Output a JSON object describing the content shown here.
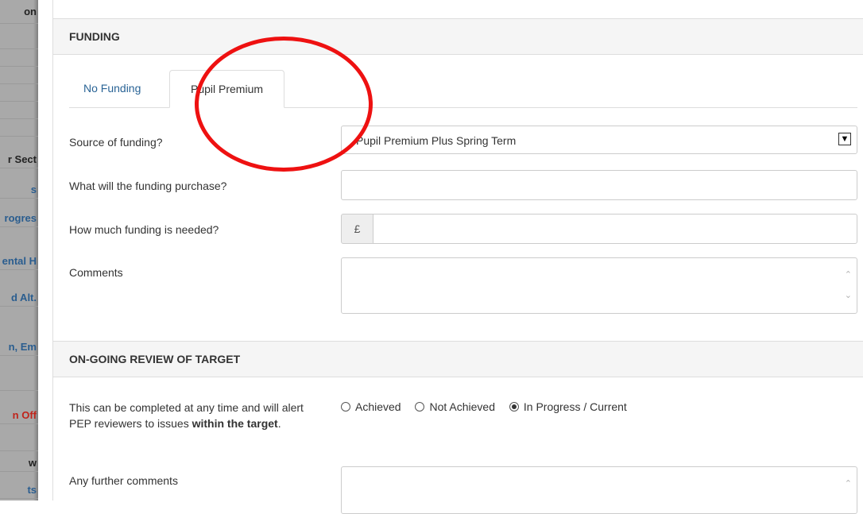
{
  "sidebar": {
    "items": [
      {
        "text": "on",
        "style": "head"
      },
      {
        "text": "",
        "style": "head"
      },
      {
        "text": "",
        "style": "head"
      },
      {
        "text": "",
        "style": "head"
      },
      {
        "text": "",
        "style": "head"
      },
      {
        "text": "",
        "style": "head"
      },
      {
        "text": "",
        "style": "head"
      },
      {
        "text": "r Sect",
        "style": "head"
      },
      {
        "text": "s",
        "style": "link"
      },
      {
        "text": "rogres",
        "style": "link"
      },
      {
        "text": "ental H",
        "style": "link"
      },
      {
        "text": "d Alt.",
        "style": "link"
      },
      {
        "text": "n, Em",
        "style": "link"
      },
      {
        "text": "",
        "style": "head"
      },
      {
        "text": "n Off",
        "style": "red"
      },
      {
        "text": "",
        "style": "head"
      },
      {
        "text": "w",
        "style": "head"
      },
      {
        "text": "ts",
        "style": "link"
      }
    ]
  },
  "funding": {
    "header": "FUNDING",
    "tabs": [
      "No Funding",
      "Pupil Premium"
    ],
    "active_tab": "Pupil Premium",
    "fields": {
      "source_label": "Source of funding?",
      "source_value": "Pupil Premium Plus Spring Term",
      "purchase_label": "What will the funding purchase?",
      "purchase_value": "",
      "amount_label": "How much funding is needed?",
      "currency_symbol": "£",
      "amount_value": "",
      "comments_label": "Comments",
      "comments_value": ""
    }
  },
  "review": {
    "header": "ON-GOING REVIEW OF TARGET",
    "description_prefix": "This can be completed at any time and will alert PEP reviewers to issues ",
    "description_bold": "within the target",
    "description_suffix": ".",
    "options": [
      "Achieved",
      "Not Achieved",
      "In Progress / Current"
    ],
    "selected": "In Progress / Current",
    "further_label": "Any further comments",
    "further_value": ""
  },
  "colors": {
    "annotation": "#ee1111",
    "link": "#2a6496",
    "sidebar_bg": "#a9a9a9",
    "sidebar_red": "#c0241b"
  },
  "icons": {
    "select_arrow": "chevron-down-icon",
    "textarea_scroll": "scroll-arrow-icon"
  }
}
